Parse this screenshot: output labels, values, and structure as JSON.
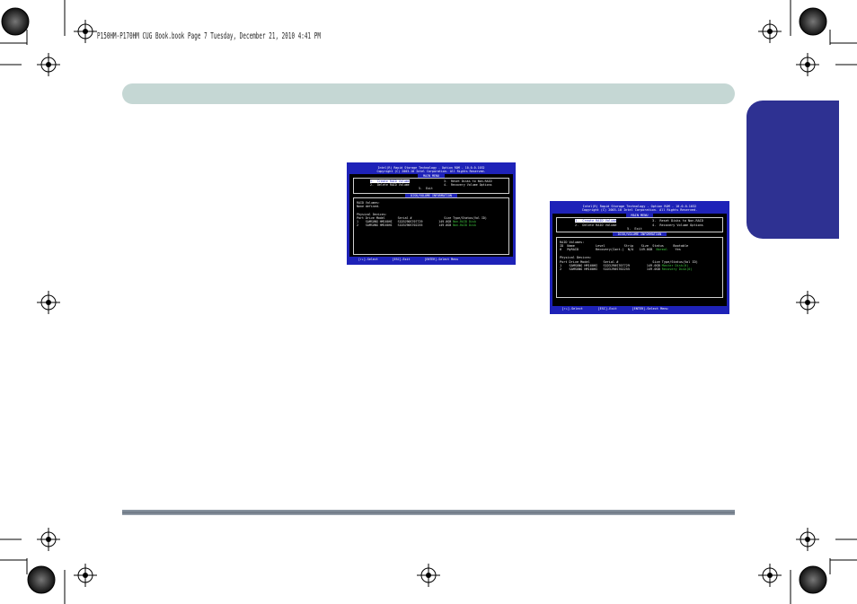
{
  "running_header": "P150HM-P170HM CUG Book.book  Page 7  Tuesday, December 21, 2010  4:41 PM",
  "colors": {
    "top_bar": "#c5d7d4",
    "side_tab": "#2e3192",
    "bios_blue": "#1e22b8",
    "bios_green": "#3fc83f"
  },
  "screen_small": {
    "title_lines": [
      "Intel(R) Rapid Storage Technology - Option ROM - 10.0.0.1032",
      "Copyright (C) 2003-10 Intel Corporation. All Rights Reserved."
    ],
    "section_main_menu": "MAIN MENU",
    "menu": {
      "opt1": "1.  Create RAID Volume",
      "opt2": "2.  Delete RAID Volume",
      "opt3": "3.  Reset Disks to Non-RAID",
      "opt4": "4.  Recovery Volume Options",
      "opt5": "5.  Exit"
    },
    "section_disk_info": "DISK/VOLUME INFORMATION",
    "raid_volumes_label": "RAID Volumes:",
    "raid_volumes_value": "None defined.",
    "physical_devices_label": "Physical Devices:",
    "pd_header": "Port Drive Model       Serial #                  Size Type/Status(Vol ID)",
    "pd_rows": [
      {
        "line": "1    SAMSUNG HM160HI   S1D3J90S707729         149.0GB ",
        "status": "Non-RAID Disk"
      },
      {
        "line": "2    SAMSUNG HM160HI   S1D3J90S702255         149.0GB ",
        "status": "Non-RAID Disk"
      }
    ],
    "footer": "     [↑↓]-Select        [ESC]-Exit        [ENTER]-Select Menu"
  },
  "screen_large": {
    "title_lines": [
      "Intel(R) Rapid Storage Technology - Option ROM - 10.0.0.1032",
      "Copyright (C) 2003-10 Intel Corporation. All Rights Reserved."
    ],
    "section_main_menu": "MAIN MENU",
    "menu": {
      "opt1": "1.  Create RAID Volume",
      "opt2": "2.  Delete RAID Volume",
      "opt3": "3.  Reset Disks to Non-RAID",
      "opt4": "4.  Recovery Volume Options",
      "opt5": "5.  Exit"
    },
    "section_disk_info": "DISK/VOLUME INFORMATION",
    "raid_volumes_label": "RAID Volumes:",
    "rv_header": "ID  Name           Level          Strip    Size  Status     Bootable",
    "rv_row": {
      "line": "0   MyRAID         Recovery(Cont.)  N/A   149.0GB  ",
      "status": "Normal",
      "bootable": "    Yes"
    },
    "physical_devices_label": "Physical Devices:",
    "pd_header": "Port Drive Model       Serial #                  Size Type/Status(Vol ID)",
    "pd_rows": [
      {
        "line": "1    SAMSUNG HM160HI   S1D3J90S707729         149.0GB ",
        "status": "Master Disk(0)"
      },
      {
        "line": "2    SAMSUNG HM160HI   S1D3J90S702255         149.0GB ",
        "status": "Recovery Disk(0)"
      }
    ],
    "footer": "     [↑↓]-Select        [ESC]-Exit        [ENTER]-Select Menu"
  }
}
